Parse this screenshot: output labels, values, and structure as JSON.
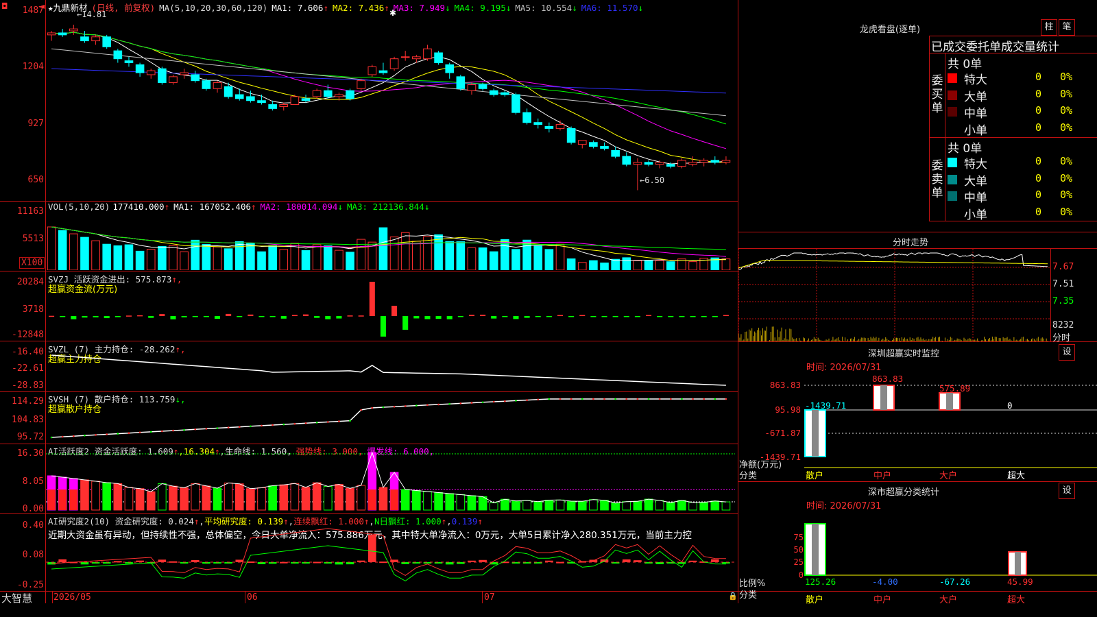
{
  "stock": {
    "star": "★",
    "name": "九鼎新材",
    "period": "(日线, 前复权)",
    "ma_params": "MA(5,10,20,30,60,120)"
  },
  "main_legend": [
    {
      "label": "MA1: 7.606",
      "arrow": "↑",
      "color": "#ffffff"
    },
    {
      "label": "MA2: 7.436",
      "arrow": "↑",
      "color": "#ffff00"
    },
    {
      "label": "MA3: 7.949",
      "arrow": "↓",
      "color": "#ff00ff"
    },
    {
      "label": "MA4: 9.195",
      "arrow": "↓",
      "color": "#00ff00"
    },
    {
      "label": "MA5: 10.554",
      "arrow": "↓",
      "color": "#c0c0c0"
    },
    {
      "label": "MA6: 11.570",
      "arrow": "↓",
      "color": "#3030ff"
    }
  ],
  "main_axis": [
    "1487",
    "1204",
    "927",
    "650"
  ],
  "high_label": "←14.81",
  "low_label": "←6.50",
  "vol": {
    "title": "VOL(5,10,20)",
    "value": "177410.000",
    "value_arrow": "↑",
    "ma1": "MA1: 167052.406",
    "ma1_arrow": "↑",
    "ma2": "MA2: 180014.094",
    "ma2_arrow": "↓",
    "ma3": "MA3: 212136.844",
    "ma3_arrow": "↓",
    "axis": [
      "11163",
      "5513"
    ],
    "unit": "X100"
  },
  "svzj": {
    "title": "SVZJ  活跃资金进出: 575.873",
    "arrow": "↑,",
    "sub": "超赢资金流(万元)",
    "axis": [
      "20284",
      "3718",
      "-12848"
    ]
  },
  "svzl": {
    "title": "SVZL (7) 主力持仓: -28.262",
    "arrow": "↑,",
    "sub": "超赢主力持仓",
    "axis": [
      "-16.40",
      "-22.61",
      "-28.83"
    ]
  },
  "svsh": {
    "title": "SVSH (7) 散户持仓: 113.759",
    "arrow": "↓,",
    "sub": "超赢散户持仓",
    "axis": [
      "114.29",
      "104.83",
      "95.72"
    ]
  },
  "ai_active": {
    "title": "AI活跃度2 资金活跃度: 1.609",
    "a1": "↑",
    "v2": "16.304",
    "a2": "↑",
    "life": "生命线: 1.560,",
    "strong": "强势线: 3.000,",
    "burst": "爆发线: 6.000,",
    "axis": [
      "16.30",
      "8.05",
      "0.00"
    ]
  },
  "ai_research": {
    "title": "AI研究度2(10) 资金研究度: 0.024",
    "a1": "↑",
    "avg": "平均研究度: 0.139",
    "a2": "↑",
    "cont": "连续飘红: 1.000",
    "a3": "↑",
    "nday": "N日飘红: 1.000",
    "a4": "↑",
    "last": "0.139",
    "a5": "↑",
    "axis": [
      "0.40",
      "0.08",
      "-0.25"
    ],
    "comment": "近期大资金虽有异动，但持续性不强，总体偏空，今日大单净流入：575.886万元，其中特大单净流入：0万元，大单5日累计净入280.351万元，当前主力控"
  },
  "date_axis": {
    "brand": "大智慧",
    "labels": [
      "2026/05",
      "06",
      "07"
    ]
  },
  "lhkp": {
    "title": "龙虎看盘(逐单)",
    "btn1": "柱",
    "btn2": "笔",
    "header": "已成交委托单成交量统计",
    "buy_label": "委买单",
    "sell_label": "委卖单",
    "buy_total": "共 0单",
    "sell_total": "共 0单",
    "buy_rows": [
      {
        "name": "特大",
        "count": "0",
        "pct": "0%",
        "color": "#ff0000"
      },
      {
        "name": "大单",
        "count": "0",
        "pct": "0%",
        "color": "#8b0000"
      },
      {
        "name": "中单",
        "count": "0",
        "pct": "0%",
        "color": "#5a0000"
      },
      {
        "name": "小单",
        "count": "0",
        "pct": "0%",
        "color": "#000000"
      }
    ],
    "sell_rows": [
      {
        "name": "特大",
        "count": "0",
        "pct": "0%",
        "color": "#00ffff"
      },
      {
        "name": "大单",
        "count": "0",
        "pct": "0%",
        "color": "#008b8b"
      },
      {
        "name": "中单",
        "count": "0",
        "pct": "0%",
        "color": "#006f6f"
      },
      {
        "name": "小单",
        "count": "0",
        "pct": "0%",
        "color": "#000000"
      }
    ]
  },
  "fenshi": {
    "title": "分时走势",
    "axis": [
      "7.67",
      "7.51",
      "7.35"
    ],
    "vol_label": "8232",
    "vol_unit": "分时"
  },
  "sz_monitor": {
    "title": "深圳超赢实时监控",
    "btn": "设",
    "time": "时间: 2026/07/31",
    "axis": [
      "863.83",
      "95.98",
      "-671.87",
      "-1439.71"
    ],
    "axis_title": "净额(万元)",
    "cat_label": "分类",
    "values": [
      {
        "label": "-1439.71",
        "color": "#00ffff"
      },
      {
        "label": "863.83",
        "color": "#ff3030"
      },
      {
        "label": "575.89",
        "color": "#ff3030"
      },
      {
        "label": "0",
        "color": "#ffffff"
      }
    ],
    "cats": [
      {
        "name": "散户",
        "color": "#ffff00"
      },
      {
        "name": "中户",
        "color": "#ff3030"
      },
      {
        "name": "大户",
        "color": "#ff3030"
      },
      {
        "name": "超大",
        "color": "#ffffff"
      }
    ]
  },
  "sz_stats": {
    "title": "深市超赢分类统计",
    "btn": "设",
    "time": "时间: 2026/07/31",
    "axis": [
      "75",
      "50",
      "25",
      "0"
    ],
    "axis_title": "比例%",
    "cat_label": "分类",
    "values": [
      {
        "label": "125.26",
        "color": "#00ff00"
      },
      {
        "label": "-4.00",
        "color": "#3070ff"
      },
      {
        "label": "-67.26",
        "color": "#00ffff"
      },
      {
        "label": "45.99",
        "color": "#ff3030"
      }
    ],
    "cats": [
      {
        "name": "散户",
        "color": "#ffff00"
      },
      {
        "name": "中户",
        "color": "#ff3030"
      },
      {
        "name": "大户",
        "color": "#ff3030"
      },
      {
        "name": "超大",
        "color": "#ff3030"
      }
    ]
  },
  "chart_data": {
    "type": "candlestick",
    "title": "九鼎新材",
    "x_labels": [
      "2026/05",
      "06",
      "07"
    ],
    "ohlc": [
      [
        14.3,
        14.5,
        14.0,
        14.4
      ],
      [
        14.4,
        14.6,
        14.2,
        14.3
      ],
      [
        14.5,
        14.81,
        14.3,
        14.6
      ],
      [
        14.2,
        14.5,
        13.9,
        14.0
      ],
      [
        14.0,
        14.3,
        13.8,
        14.2
      ],
      [
        14.2,
        14.3,
        13.6,
        13.7
      ],
      [
        13.5,
        13.6,
        12.9,
        13.1
      ],
      [
        13.0,
        13.2,
        12.7,
        12.9
      ],
      [
        12.8,
        12.9,
        12.2,
        12.4
      ],
      [
        12.3,
        12.6,
        12.1,
        12.5
      ],
      [
        12.6,
        12.7,
        11.8,
        11.9
      ],
      [
        11.9,
        12.3,
        11.8,
        12.2
      ],
      [
        12.3,
        12.6,
        12.1,
        12.4
      ],
      [
        12.3,
        12.5,
        11.9,
        12.0
      ],
      [
        12.0,
        12.1,
        11.5,
        11.6
      ],
      [
        11.6,
        12.0,
        11.4,
        11.9
      ],
      [
        11.7,
        11.9,
        11.1,
        11.2
      ],
      [
        11.3,
        11.6,
        11.0,
        11.1
      ],
      [
        11.2,
        11.5,
        10.9,
        11.0
      ],
      [
        11.0,
        11.3,
        10.8,
        10.9
      ],
      [
        10.8,
        11.0,
        10.5,
        10.6
      ],
      [
        10.7,
        10.9,
        10.5,
        10.8
      ],
      [
        10.8,
        11.3,
        10.8,
        11.2
      ],
      [
        11.1,
        11.3,
        10.9,
        11.0
      ],
      [
        11.2,
        11.6,
        11.1,
        11.5
      ],
      [
        11.5,
        11.8,
        11.1,
        11.2
      ],
      [
        11.2,
        11.4,
        11.0,
        11.3
      ],
      [
        11.5,
        11.6,
        11.0,
        11.1
      ],
      [
        11.6,
        12.1,
        11.5,
        12.0
      ],
      [
        12.3,
        12.8,
        12.2,
        12.7
      ],
      [
        12.5,
        12.9,
        12.3,
        12.4
      ],
      [
        12.6,
        13.2,
        12.5,
        13.1
      ],
      [
        13.2,
        13.5,
        13.0,
        13.2
      ],
      [
        13.1,
        13.3,
        12.9,
        13.2
      ],
      [
        13.1,
        13.8,
        13.0,
        13.6
      ],
      [
        13.4,
        13.5,
        12.8,
        12.9
      ],
      [
        12.8,
        12.9,
        12.1,
        12.4
      ],
      [
        12.2,
        12.3,
        11.5,
        11.6
      ],
      [
        11.5,
        11.9,
        11.3,
        11.8
      ],
      [
        11.8,
        11.9,
        11.5,
        11.6
      ],
      [
        11.5,
        11.6,
        11.2,
        11.3
      ],
      [
        11.4,
        11.5,
        11.2,
        11.3
      ],
      [
        11.3,
        11.4,
        10.3,
        10.4
      ],
      [
        10.4,
        10.6,
        9.8,
        9.9
      ],
      [
        9.9,
        10.1,
        9.6,
        9.8
      ],
      [
        9.7,
        9.9,
        9.4,
        9.6
      ],
      [
        9.6,
        10.0,
        9.5,
        9.8
      ],
      [
        9.6,
        9.7,
        8.8,
        8.9
      ],
      [
        8.8,
        9.0,
        8.6,
        9.0
      ],
      [
        8.9,
        9.0,
        8.6,
        8.7
      ],
      [
        8.7,
        8.9,
        8.5,
        8.6
      ],
      [
        8.5,
        8.7,
        8.1,
        8.2
      ],
      [
        8.2,
        8.4,
        7.7,
        7.8
      ],
      [
        7.8,
        8.1,
        6.5,
        7.9
      ],
      [
        7.9,
        8.0,
        7.7,
        7.8
      ],
      [
        7.8,
        8.0,
        7.6,
        7.9
      ],
      [
        7.8,
        7.9,
        7.6,
        7.7
      ],
      [
        7.7,
        8.1,
        7.6,
        8.0
      ],
      [
        7.8,
        8.2,
        7.7,
        7.9
      ],
      [
        7.9,
        8.1,
        7.7,
        8.0
      ],
      [
        8.0,
        8.2,
        7.8,
        7.9
      ],
      [
        7.9,
        8.2,
        7.8,
        8.0
      ]
    ],
    "ylim": [
      6.0,
      15.5
    ]
  }
}
